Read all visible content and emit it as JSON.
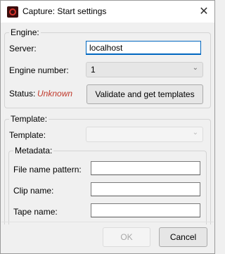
{
  "window": {
    "title": "Capture: Start settings",
    "close_glyph": "✕"
  },
  "engine": {
    "legend": "Engine:",
    "server_label": "Server:",
    "server_value": "localhost",
    "number_label": "Engine number:",
    "number_value": "1",
    "status_label": "Status:",
    "status_value": "Unknown",
    "validate_label": "Validate and get templates"
  },
  "template": {
    "legend": "Template:",
    "template_label": "Template:",
    "template_value": ""
  },
  "metadata": {
    "legend": "Metadata:",
    "fields": [
      {
        "label": "File name pattern:",
        "value": ""
      },
      {
        "label": "Clip name:",
        "value": ""
      },
      {
        "label": "Tape name:",
        "value": ""
      }
    ]
  },
  "footer": {
    "ok_label": "OK",
    "cancel_label": "Cancel"
  },
  "icons": {
    "app": "capture-app-icon",
    "close": "close-icon",
    "dropdown": "chevron-down-icon"
  }
}
